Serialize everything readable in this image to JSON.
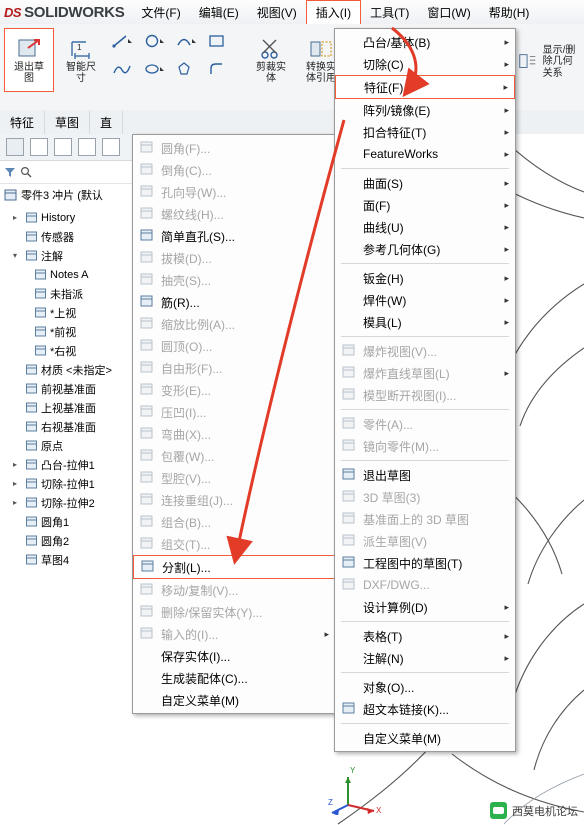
{
  "app": {
    "brand_ds": "DS",
    "brand_name": "SOLIDWORKS",
    "accent_color": "#f25c3b",
    "logo_red": "#b31b1b"
  },
  "menubar": [
    {
      "label": "文件(F)",
      "active": false
    },
    {
      "label": "编辑(E)",
      "active": false
    },
    {
      "label": "视图(V)",
      "active": false
    },
    {
      "label": "插入(I)",
      "active": true
    },
    {
      "label": "工具(T)",
      "active": false
    },
    {
      "label": "窗口(W)",
      "active": false
    },
    {
      "label": "帮助(H)",
      "active": false
    }
  ],
  "toolbar": {
    "exit_sketch": "退出草\n图",
    "smart_dim": "智能尺\n寸",
    "trim": "剪裁实\n体",
    "convert": "转换实\n体引用",
    "display_delete": "显示/删\n除几何\n关系"
  },
  "tabs": [
    {
      "label": "特征"
    },
    {
      "label": "草图"
    },
    {
      "label": "直"
    }
  ],
  "tree": {
    "header": "零件3 冲片 (默认",
    "items": [
      {
        "label": "History",
        "indent": 1,
        "arrow": "▸",
        "icon": "history-icon"
      },
      {
        "label": "传感器",
        "indent": 1,
        "arrow": "",
        "icon": "sensor-icon"
      },
      {
        "label": "注解",
        "indent": 1,
        "arrow": "▾",
        "icon": "annotations-icon"
      },
      {
        "label": "Notes A",
        "indent": 2,
        "arrow": "",
        "icon": "note-icon"
      },
      {
        "label": "未指派",
        "indent": 2,
        "arrow": "",
        "icon": "unassigned-icon"
      },
      {
        "label": "*上视",
        "indent": 2,
        "arrow": "",
        "icon": "view-icon"
      },
      {
        "label": "*前视",
        "indent": 2,
        "arrow": "",
        "icon": "view-icon"
      },
      {
        "label": "*右视",
        "indent": 2,
        "arrow": "",
        "icon": "view-icon"
      },
      {
        "label": "材质 <未指定>",
        "indent": 1,
        "arrow": "",
        "icon": "material-icon"
      },
      {
        "label": "前视基准面",
        "indent": 1,
        "arrow": "",
        "icon": "plane-icon"
      },
      {
        "label": "上视基准面",
        "indent": 1,
        "arrow": "",
        "icon": "plane-icon"
      },
      {
        "label": "右视基准面",
        "indent": 1,
        "arrow": "",
        "icon": "plane-icon"
      },
      {
        "label": "原点",
        "indent": 1,
        "arrow": "",
        "icon": "origin-icon"
      },
      {
        "label": "凸台-拉伸1",
        "indent": 1,
        "arrow": "▸",
        "icon": "extrude-icon"
      },
      {
        "label": "切除-拉伸1",
        "indent": 1,
        "arrow": "▸",
        "icon": "cut-icon"
      },
      {
        "label": "切除-拉伸2",
        "indent": 1,
        "arrow": "▸",
        "icon": "cut-icon"
      },
      {
        "label": "圆角1",
        "indent": 1,
        "arrow": "",
        "icon": "fillet-icon"
      },
      {
        "label": "圆角2",
        "indent": 1,
        "arrow": "",
        "icon": "fillet-icon"
      },
      {
        "label": "草图4",
        "indent": 1,
        "arrow": "",
        "icon": "sketch-icon"
      }
    ]
  },
  "insert_menu": [
    {
      "label": "圆角(F)...",
      "disabled": true,
      "arrow": "",
      "icon": "fillet-icon"
    },
    {
      "label": "倒角(C)...",
      "disabled": true,
      "arrow": "",
      "icon": "chamfer-icon"
    },
    {
      "label": "孔向导(W)...",
      "disabled": true,
      "arrow": "",
      "icon": "hole-wizard-icon"
    },
    {
      "label": "螺纹线(H)...",
      "disabled": true,
      "arrow": "",
      "icon": "thread-icon"
    },
    {
      "label": "简单直孔(S)...",
      "disabled": false,
      "arrow": "",
      "icon": "simple-hole-icon"
    },
    {
      "label": "拔模(D)...",
      "disabled": true,
      "arrow": "",
      "icon": "draft-icon"
    },
    {
      "label": "抽壳(S)...",
      "disabled": true,
      "arrow": "",
      "icon": "shell-icon"
    },
    {
      "label": "筋(R)...",
      "disabled": false,
      "arrow": "",
      "icon": "rib-icon"
    },
    {
      "label": "缩放比例(A)...",
      "disabled": true,
      "arrow": "",
      "icon": "scale-icon"
    },
    {
      "label": "圆顶(O)...",
      "disabled": true,
      "arrow": "",
      "icon": "dome-icon"
    },
    {
      "label": "自由形(F)...",
      "disabled": true,
      "arrow": "",
      "icon": "freeform-icon"
    },
    {
      "label": "变形(E)...",
      "disabled": true,
      "arrow": "",
      "icon": "deform-icon"
    },
    {
      "label": "压凹(I)...",
      "disabled": true,
      "arrow": "",
      "icon": "indent-icon"
    },
    {
      "label": "弯曲(X)...",
      "disabled": true,
      "arrow": "",
      "icon": "flex-icon"
    },
    {
      "label": "包覆(W)...",
      "disabled": true,
      "arrow": "",
      "icon": "wrap-icon"
    },
    {
      "label": "型腔(V)...",
      "disabled": true,
      "arrow": "",
      "icon": "cavity-icon"
    },
    {
      "label": "连接重组(J)...",
      "disabled": true,
      "arrow": "",
      "icon": "join-icon"
    },
    {
      "label": "组合(B)...",
      "disabled": true,
      "arrow": "",
      "icon": "combine-icon"
    },
    {
      "label": "组交(T)...",
      "disabled": true,
      "arrow": "",
      "icon": "intersect-icon"
    },
    {
      "label": "分割(L)...",
      "disabled": false,
      "arrow": "",
      "icon": "split-icon",
      "selected": true
    },
    {
      "label": "移动/复制(V)...",
      "disabled": true,
      "arrow": "",
      "icon": "move-copy-icon"
    },
    {
      "label": "删除/保留实体(Y)...",
      "disabled": true,
      "arrow": "",
      "icon": "delete-body-icon"
    },
    {
      "label": "输入的(I)...",
      "disabled": true,
      "arrow": "▸",
      "icon": "imported-icon"
    },
    {
      "label": "保存实体(I)...",
      "disabled": false,
      "arrow": "",
      "icon": ""
    },
    {
      "label": "生成装配体(C)...",
      "disabled": false,
      "arrow": "",
      "icon": ""
    },
    {
      "label": "自定义菜单(M)",
      "disabled": false,
      "arrow": "",
      "icon": ""
    }
  ],
  "feature_menu": [
    {
      "label": "凸台/基体(B)",
      "disabled": false,
      "arrow": "▸",
      "icon": ""
    },
    {
      "label": "切除(C)",
      "disabled": false,
      "arrow": "▸",
      "icon": ""
    },
    {
      "label": "特征(F)",
      "disabled": false,
      "arrow": "▸",
      "icon": "",
      "selected": true
    },
    {
      "label": "阵列/镜像(E)",
      "disabled": false,
      "arrow": "▸",
      "icon": ""
    },
    {
      "label": "扣合特征(T)",
      "disabled": false,
      "arrow": "▸",
      "icon": ""
    },
    {
      "label": "FeatureWorks",
      "disabled": false,
      "arrow": "▸",
      "icon": ""
    },
    {
      "sep": true
    },
    {
      "label": "曲面(S)",
      "disabled": false,
      "arrow": "▸",
      "icon": ""
    },
    {
      "label": "面(F)",
      "disabled": false,
      "arrow": "▸",
      "icon": ""
    },
    {
      "label": "曲线(U)",
      "disabled": false,
      "arrow": "▸",
      "icon": ""
    },
    {
      "label": "参考几何体(G)",
      "disabled": false,
      "arrow": "▸",
      "icon": ""
    },
    {
      "sep": true
    },
    {
      "label": "钣金(H)",
      "disabled": false,
      "arrow": "▸",
      "icon": ""
    },
    {
      "label": "焊件(W)",
      "disabled": false,
      "arrow": "▸",
      "icon": ""
    },
    {
      "label": "模具(L)",
      "disabled": false,
      "arrow": "▸",
      "icon": ""
    },
    {
      "sep": true
    },
    {
      "label": "爆炸视图(V)...",
      "disabled": true,
      "arrow": "",
      "icon": "explode-icon"
    },
    {
      "label": "爆炸直线草图(L)",
      "disabled": true,
      "arrow": "▸",
      "icon": "explode-line-icon"
    },
    {
      "label": "模型断开视图(I)...",
      "disabled": true,
      "arrow": "",
      "icon": "break-view-icon"
    },
    {
      "sep": true
    },
    {
      "label": "零件(A)...",
      "disabled": true,
      "arrow": "",
      "icon": "part-icon"
    },
    {
      "label": "镜向零件(M)...",
      "disabled": true,
      "arrow": "",
      "icon": "mirror-part-icon"
    },
    {
      "sep": true
    },
    {
      "label": "退出草图",
      "disabled": false,
      "arrow": "",
      "icon": "exit-sketch-icon"
    },
    {
      "label": "3D 草图(3)",
      "disabled": true,
      "arrow": "",
      "icon": "3d-sketch-icon"
    },
    {
      "label": "基准面上的 3D 草图",
      "disabled": true,
      "arrow": "",
      "icon": "3d-sketch-plane-icon"
    },
    {
      "label": "派生草图(V)",
      "disabled": true,
      "arrow": "",
      "icon": "derived-sketch-icon"
    },
    {
      "label": "工程图中的草图(T)",
      "disabled": false,
      "arrow": "",
      "icon": "drawing-sketch-icon"
    },
    {
      "label": "DXF/DWG...",
      "disabled": true,
      "arrow": "",
      "icon": "dxf-icon"
    },
    {
      "label": "设计算例(D)",
      "disabled": false,
      "arrow": "▸",
      "icon": ""
    },
    {
      "sep": true
    },
    {
      "label": "表格(T)",
      "disabled": false,
      "arrow": "▸",
      "icon": ""
    },
    {
      "label": "注解(N)",
      "disabled": false,
      "arrow": "▸",
      "icon": ""
    },
    {
      "sep": true
    },
    {
      "label": "对象(O)...",
      "disabled": false,
      "arrow": "",
      "icon": ""
    },
    {
      "label": "超文本链接(K)...",
      "disabled": false,
      "arrow": "",
      "icon": "hyperlink-icon"
    },
    {
      "sep": true
    },
    {
      "label": "自定义菜单(M)",
      "disabled": false,
      "arrow": "",
      "icon": ""
    }
  ],
  "watermark": {
    "text": "西莫电机论坛"
  },
  "triad": {
    "x": "X",
    "y": "Y",
    "z": "Z"
  }
}
